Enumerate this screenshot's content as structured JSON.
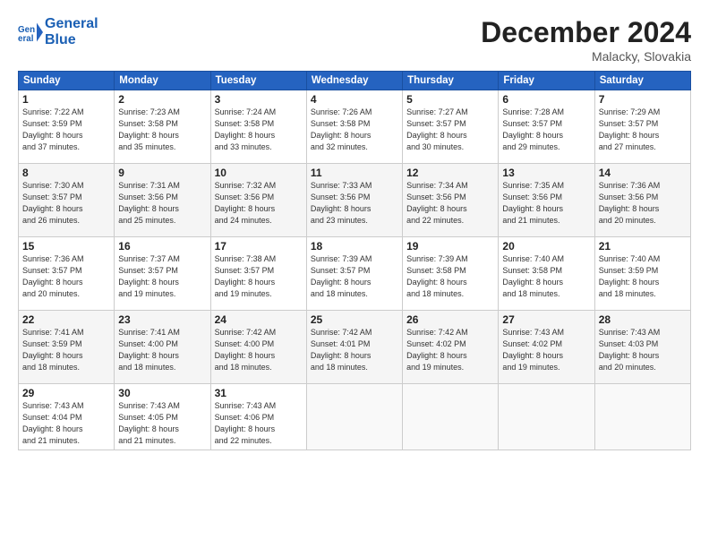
{
  "header": {
    "logo_line1": "General",
    "logo_line2": "Blue",
    "month": "December 2024",
    "location": "Malacky, Slovakia"
  },
  "days_of_week": [
    "Sunday",
    "Monday",
    "Tuesday",
    "Wednesday",
    "Thursday",
    "Friday",
    "Saturday"
  ],
  "weeks": [
    [
      {
        "day": "1",
        "info": "Sunrise: 7:22 AM\nSunset: 3:59 PM\nDaylight: 8 hours\nand 37 minutes."
      },
      {
        "day": "2",
        "info": "Sunrise: 7:23 AM\nSunset: 3:58 PM\nDaylight: 8 hours\nand 35 minutes."
      },
      {
        "day": "3",
        "info": "Sunrise: 7:24 AM\nSunset: 3:58 PM\nDaylight: 8 hours\nand 33 minutes."
      },
      {
        "day": "4",
        "info": "Sunrise: 7:26 AM\nSunset: 3:58 PM\nDaylight: 8 hours\nand 32 minutes."
      },
      {
        "day": "5",
        "info": "Sunrise: 7:27 AM\nSunset: 3:57 PM\nDaylight: 8 hours\nand 30 minutes."
      },
      {
        "day": "6",
        "info": "Sunrise: 7:28 AM\nSunset: 3:57 PM\nDaylight: 8 hours\nand 29 minutes."
      },
      {
        "day": "7",
        "info": "Sunrise: 7:29 AM\nSunset: 3:57 PM\nDaylight: 8 hours\nand 27 minutes."
      }
    ],
    [
      {
        "day": "8",
        "info": "Sunrise: 7:30 AM\nSunset: 3:57 PM\nDaylight: 8 hours\nand 26 minutes."
      },
      {
        "day": "9",
        "info": "Sunrise: 7:31 AM\nSunset: 3:56 PM\nDaylight: 8 hours\nand 25 minutes."
      },
      {
        "day": "10",
        "info": "Sunrise: 7:32 AM\nSunset: 3:56 PM\nDaylight: 8 hours\nand 24 minutes."
      },
      {
        "day": "11",
        "info": "Sunrise: 7:33 AM\nSunset: 3:56 PM\nDaylight: 8 hours\nand 23 minutes."
      },
      {
        "day": "12",
        "info": "Sunrise: 7:34 AM\nSunset: 3:56 PM\nDaylight: 8 hours\nand 22 minutes."
      },
      {
        "day": "13",
        "info": "Sunrise: 7:35 AM\nSunset: 3:56 PM\nDaylight: 8 hours\nand 21 minutes."
      },
      {
        "day": "14",
        "info": "Sunrise: 7:36 AM\nSunset: 3:56 PM\nDaylight: 8 hours\nand 20 minutes."
      }
    ],
    [
      {
        "day": "15",
        "info": "Sunrise: 7:36 AM\nSunset: 3:57 PM\nDaylight: 8 hours\nand 20 minutes."
      },
      {
        "day": "16",
        "info": "Sunrise: 7:37 AM\nSunset: 3:57 PM\nDaylight: 8 hours\nand 19 minutes."
      },
      {
        "day": "17",
        "info": "Sunrise: 7:38 AM\nSunset: 3:57 PM\nDaylight: 8 hours\nand 19 minutes."
      },
      {
        "day": "18",
        "info": "Sunrise: 7:39 AM\nSunset: 3:57 PM\nDaylight: 8 hours\nand 18 minutes."
      },
      {
        "day": "19",
        "info": "Sunrise: 7:39 AM\nSunset: 3:58 PM\nDaylight: 8 hours\nand 18 minutes."
      },
      {
        "day": "20",
        "info": "Sunrise: 7:40 AM\nSunset: 3:58 PM\nDaylight: 8 hours\nand 18 minutes."
      },
      {
        "day": "21",
        "info": "Sunrise: 7:40 AM\nSunset: 3:59 PM\nDaylight: 8 hours\nand 18 minutes."
      }
    ],
    [
      {
        "day": "22",
        "info": "Sunrise: 7:41 AM\nSunset: 3:59 PM\nDaylight: 8 hours\nand 18 minutes."
      },
      {
        "day": "23",
        "info": "Sunrise: 7:41 AM\nSunset: 4:00 PM\nDaylight: 8 hours\nand 18 minutes."
      },
      {
        "day": "24",
        "info": "Sunrise: 7:42 AM\nSunset: 4:00 PM\nDaylight: 8 hours\nand 18 minutes."
      },
      {
        "day": "25",
        "info": "Sunrise: 7:42 AM\nSunset: 4:01 PM\nDaylight: 8 hours\nand 18 minutes."
      },
      {
        "day": "26",
        "info": "Sunrise: 7:42 AM\nSunset: 4:02 PM\nDaylight: 8 hours\nand 19 minutes."
      },
      {
        "day": "27",
        "info": "Sunrise: 7:43 AM\nSunset: 4:02 PM\nDaylight: 8 hours\nand 19 minutes."
      },
      {
        "day": "28",
        "info": "Sunrise: 7:43 AM\nSunset: 4:03 PM\nDaylight: 8 hours\nand 20 minutes."
      }
    ],
    [
      {
        "day": "29",
        "info": "Sunrise: 7:43 AM\nSunset: 4:04 PM\nDaylight: 8 hours\nand 21 minutes."
      },
      {
        "day": "30",
        "info": "Sunrise: 7:43 AM\nSunset: 4:05 PM\nDaylight: 8 hours\nand 21 minutes."
      },
      {
        "day": "31",
        "info": "Sunrise: 7:43 AM\nSunset: 4:06 PM\nDaylight: 8 hours\nand 22 minutes."
      },
      {
        "day": "",
        "info": ""
      },
      {
        "day": "",
        "info": ""
      },
      {
        "day": "",
        "info": ""
      },
      {
        "day": "",
        "info": ""
      }
    ]
  ]
}
